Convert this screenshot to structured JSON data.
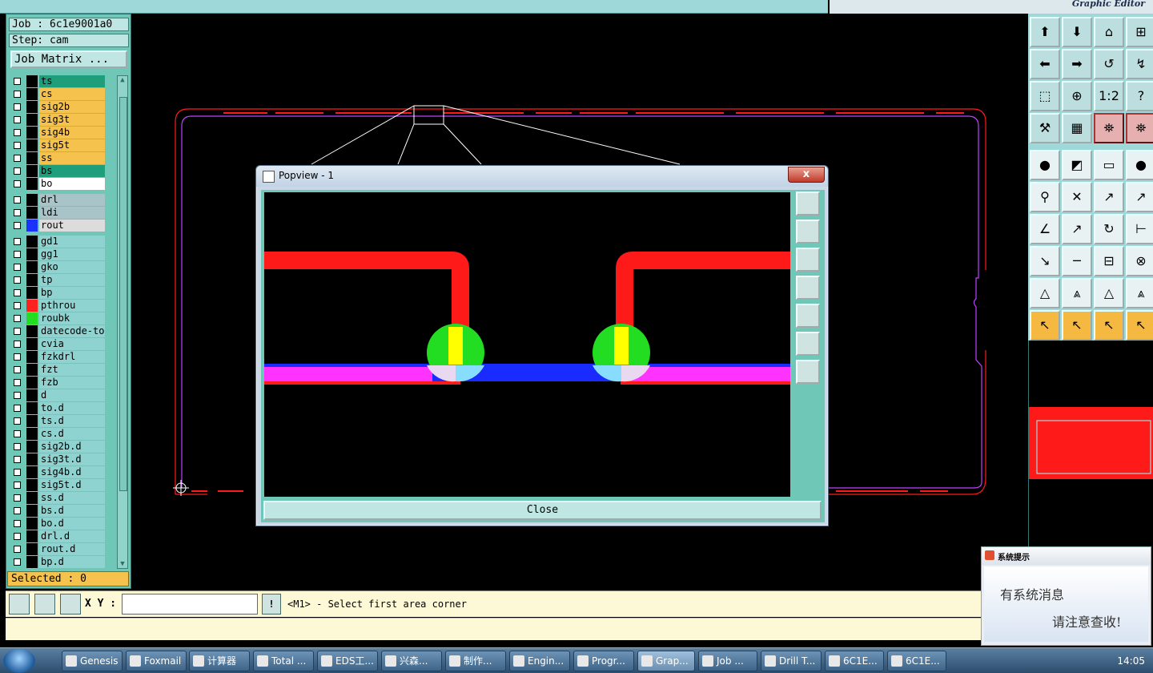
{
  "topbar": {
    "brand": "Graphic Editor"
  },
  "left_panel": {
    "job": "Job : 6c1e9001a0",
    "step": "Step: cam",
    "job_matrix_button": "Job Matrix ...",
    "selected": "Selected : 0",
    "layers": [
      {
        "name": "ts",
        "color": "#1e9e7a",
        "swatch": "#000000",
        "mark": ""
      },
      {
        "name": "cs",
        "color": "#f6c24e",
        "swatch": "#000000",
        "mark": "✎"
      },
      {
        "name": "sig2b",
        "color": "#f6c24e",
        "swatch": "#000000",
        "mark": ""
      },
      {
        "name": "sig3t",
        "color": "#f6c24e",
        "swatch": "#000000",
        "mark": ""
      },
      {
        "name": "sig4b",
        "color": "#f6c24e",
        "swatch": "#000000",
        "mark": ""
      },
      {
        "name": "sig5t",
        "color": "#f6c24e",
        "swatch": "#000000",
        "mark": ""
      },
      {
        "name": "ss",
        "color": "#f6c24e",
        "swatch": "#000000",
        "mark": "✎"
      },
      {
        "name": "bs",
        "color": "#1e9e7a",
        "swatch": "#000000",
        "mark": "✎"
      },
      {
        "name": "bo",
        "color": "#ffffff",
        "swatch": "#000000",
        "mark": "✎"
      },
      {
        "name": "drl",
        "color": "#a8c4c8",
        "swatch": "#000000",
        "mark": ""
      },
      {
        "name": "ldi",
        "color": "#a8c4c8",
        "swatch": "#000000",
        "mark": ""
      },
      {
        "name": "rout",
        "color": "#dcdcdc",
        "swatch": "#1a33ff",
        "mark": ""
      },
      {
        "name": "gd1",
        "color": "#8fd3d0",
        "swatch": "#000000",
        "mark": "✎"
      },
      {
        "name": "gg1",
        "color": "#8fd3d0",
        "swatch": "#000000",
        "mark": ""
      },
      {
        "name": "gko",
        "color": "#8fd3d0",
        "swatch": "#000000",
        "mark": ""
      },
      {
        "name": "tp",
        "color": "#8fd3d0",
        "swatch": "#000000",
        "mark": ""
      },
      {
        "name": "bp",
        "color": "#8fd3d0",
        "swatch": "#000000",
        "mark": ""
      },
      {
        "name": "pthrou",
        "color": "#8fd3d0",
        "swatch": "#ff2020",
        "mark": ""
      },
      {
        "name": "roubk",
        "color": "#8fd3d0",
        "swatch": "#22dd22",
        "mark": "⊞"
      },
      {
        "name": "datecode-to",
        "color": "#8fd3d0",
        "swatch": "#000000",
        "mark": ""
      },
      {
        "name": "cvia",
        "color": "#8fd3d0",
        "swatch": "#000000",
        "mark": ""
      },
      {
        "name": "fzkdrl",
        "color": "#8fd3d0",
        "swatch": "#000000",
        "mark": ""
      },
      {
        "name": "fzt",
        "color": "#8fd3d0",
        "swatch": "#000000",
        "mark": ""
      },
      {
        "name": "fzb",
        "color": "#8fd3d0",
        "swatch": "#000000",
        "mark": ""
      },
      {
        "name": "d",
        "color": "#8fd3d0",
        "swatch": "#000000",
        "mark": ""
      },
      {
        "name": "to.d",
        "color": "#8fd3d0",
        "swatch": "#000000",
        "mark": "✎"
      },
      {
        "name": "ts.d",
        "color": "#8fd3d0",
        "swatch": "#000000",
        "mark": ""
      },
      {
        "name": "cs.d",
        "color": "#8fd3d0",
        "swatch": "#000000",
        "mark": "✎"
      },
      {
        "name": "sig2b.d",
        "color": "#8fd3d0",
        "swatch": "#000000",
        "mark": ""
      },
      {
        "name": "sig3t.d",
        "color": "#8fd3d0",
        "swatch": "#000000",
        "mark": ""
      },
      {
        "name": "sig4b.d",
        "color": "#8fd3d0",
        "swatch": "#000000",
        "mark": ""
      },
      {
        "name": "sig5t.d",
        "color": "#8fd3d0",
        "swatch": "#000000",
        "mark": ""
      },
      {
        "name": "ss.d",
        "color": "#8fd3d0",
        "swatch": "#000000",
        "mark": "✎"
      },
      {
        "name": "bs.d",
        "color": "#8fd3d0",
        "swatch": "#000000",
        "mark": "✎"
      },
      {
        "name": "bo.d",
        "color": "#8fd3d0",
        "swatch": "#000000",
        "mark": "✎"
      },
      {
        "name": "drl.d",
        "color": "#8fd3d0",
        "swatch": "#000000",
        "mark": ""
      },
      {
        "name": "rout.d",
        "color": "#8fd3d0",
        "swatch": "#000000",
        "mark": ""
      },
      {
        "name": "bp.d",
        "color": "#8fd3d0",
        "swatch": "#000000",
        "mark": ""
      }
    ]
  },
  "command_bar": {
    "xy_label": "X Y :",
    "xy_value": "",
    "excl_label": "!",
    "prompt": "<M1> - Select first area corner"
  },
  "popview": {
    "title": "Popview - 1",
    "close_x": "x",
    "close_button": "Close"
  },
  "notification": {
    "title": "系统提示",
    "line1": "有系统消息",
    "line2": "请注意查收!"
  },
  "right_toolbar": {
    "glyphs": [
      "⬆",
      "⬇",
      "⌂",
      "⊞",
      "⬅",
      "➡",
      "↺",
      "↯",
      "⬚",
      "⊕",
      "1:2",
      "?",
      "⚒",
      "▦",
      "⛯",
      "⛯",
      "●",
      "◩",
      "▭",
      "●",
      "⚲",
      "✕",
      "↗",
      "↗",
      "∠",
      "↗",
      "↻",
      "⊢",
      "↘",
      "─",
      "⊟",
      "⊗",
      "△",
      "⩓",
      "△",
      "⩓",
      "↖",
      "↖",
      "↖",
      "↖"
    ]
  },
  "taskbar": {
    "items": [
      {
        "label": "Genesis"
      },
      {
        "label": "Foxmail"
      },
      {
        "label": "计算器"
      },
      {
        "label": "Total ..."
      },
      {
        "label": "EDS工..."
      },
      {
        "label": "兴森..."
      },
      {
        "label": "制作..."
      },
      {
        "label": "Engin..."
      },
      {
        "label": "Progr..."
      },
      {
        "label": "Grap..."
      },
      {
        "label": "Job ..."
      },
      {
        "label": "Drill T..."
      },
      {
        "label": "6C1E..."
      },
      {
        "label": "6C1E..."
      }
    ],
    "clock": "14:05"
  },
  "colors": {
    "panel": "#6fc7b8",
    "trace_red": "#ff1a1a",
    "trace_blue": "#1a2bff",
    "trace_magenta": "#ff33ff",
    "pad_green": "#22dd22",
    "pad_yellow": "#ffff00"
  }
}
